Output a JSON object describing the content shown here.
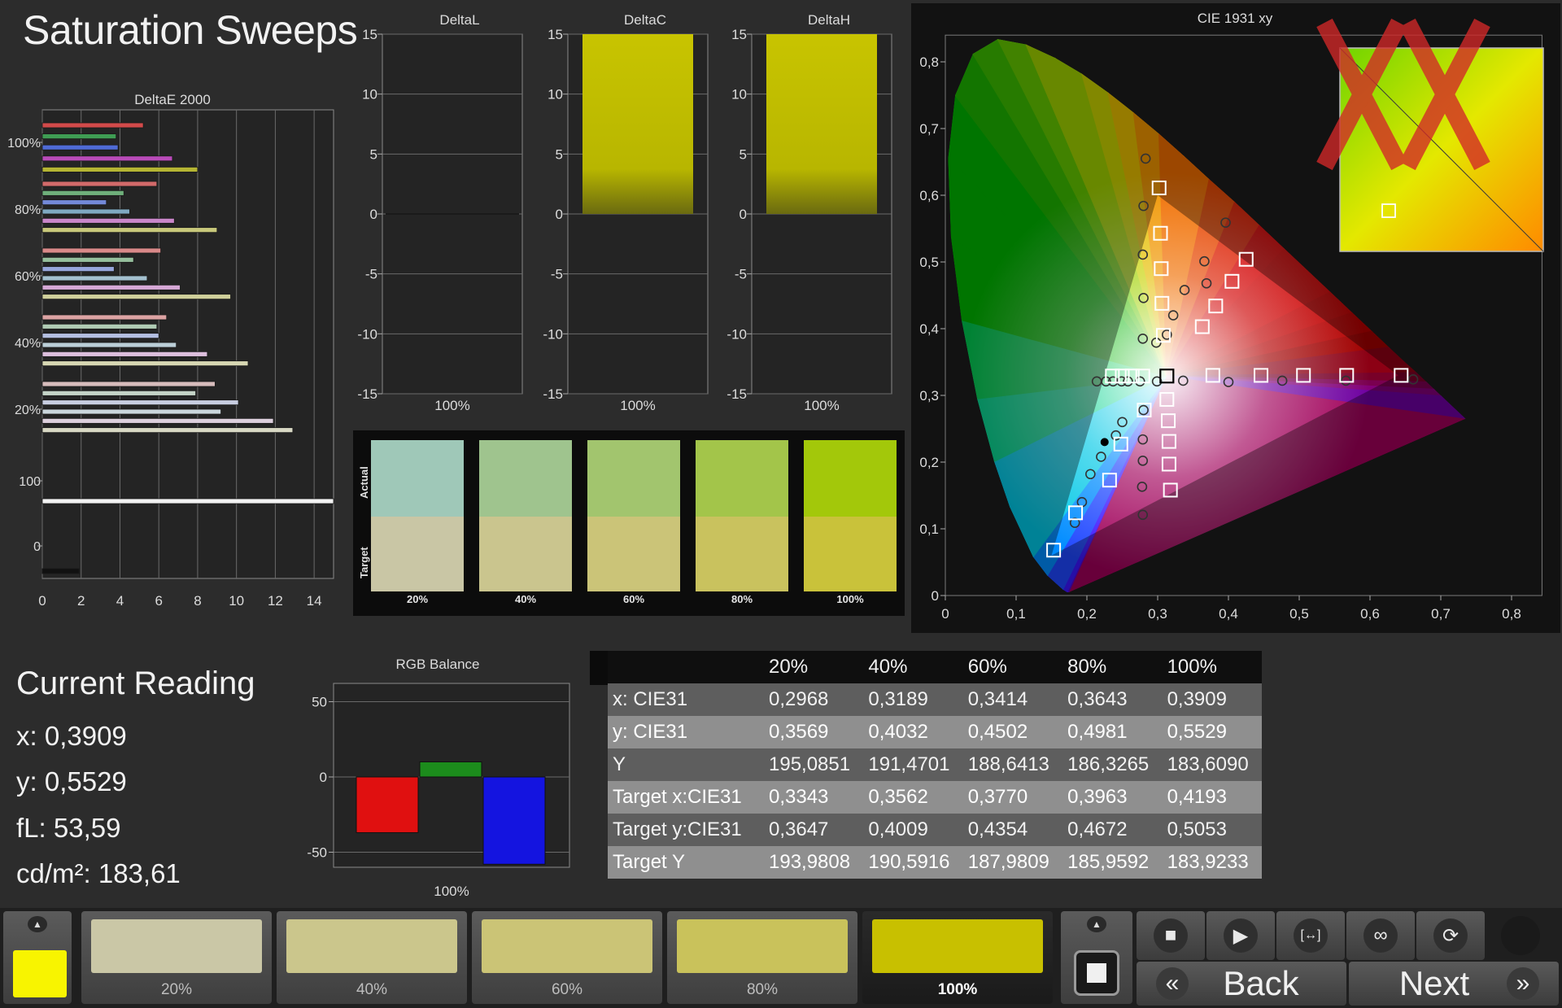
{
  "app": {
    "title": "Saturation Sweeps",
    "logo_icon": "watermark-x-icon"
  },
  "deltae": {
    "title": "DeltaE 2000",
    "xticks": [
      "0",
      "2",
      "4",
      "6",
      "8",
      "10",
      "12",
      "14"
    ],
    "yticks": [
      "100%",
      "80%",
      "60%",
      "40%",
      "20%",
      "100",
      "0"
    ],
    "groups": [
      {
        "label": "100%",
        "bars": [
          {
            "v": 5.2,
            "c": "#d24a4a"
          },
          {
            "v": 3.8,
            "c": "#3f9d54"
          },
          {
            "v": 3.9,
            "c": "#4f6bd6"
          },
          {
            "v": 6.7,
            "c": "#b94bb9"
          },
          {
            "v": 8.0,
            "c": "#b5b533"
          }
        ]
      },
      {
        "label": "80%",
        "bars": [
          {
            "v": 5.9,
            "c": "#d26a6a"
          },
          {
            "v": 4.2,
            "c": "#6fb07b"
          },
          {
            "v": 3.3,
            "c": "#7389d8"
          },
          {
            "v": 4.5,
            "c": "#7fa9c2"
          },
          {
            "v": 6.8,
            "c": "#c986c9"
          },
          {
            "v": 9.0,
            "c": "#c8c87b"
          }
        ]
      },
      {
        "label": "60%",
        "bars": [
          {
            "v": 6.1,
            "c": "#d98989"
          },
          {
            "v": 4.7,
            "c": "#96bf9d"
          },
          {
            "v": 3.7,
            "c": "#97a6dc"
          },
          {
            "v": 5.4,
            "c": "#a4c0cf"
          },
          {
            "v": 7.1,
            "c": "#d6a8d6"
          },
          {
            "v": 9.7,
            "c": "#d0d09b"
          }
        ]
      },
      {
        "label": "40%",
        "bars": [
          {
            "v": 6.4,
            "c": "#dca3a3"
          },
          {
            "v": 5.9,
            "c": "#b0cbb4"
          },
          {
            "v": 6.0,
            "c": "#b4bfe1"
          },
          {
            "v": 6.9,
            "c": "#bccfd8"
          },
          {
            "v": 8.5,
            "c": "#ddbfdd"
          },
          {
            "v": 10.6,
            "c": "#d7d7b3"
          }
        ]
      },
      {
        "label": "20%",
        "bars": [
          {
            "v": 8.9,
            "c": "#d7bcbc"
          },
          {
            "v": 7.9,
            "c": "#c4d3c7"
          },
          {
            "v": 10.1,
            "c": "#c7cde0"
          },
          {
            "v": 9.2,
            "c": "#cad6dc"
          },
          {
            "v": 11.9,
            "c": "#dccfdc"
          },
          {
            "v": 12.9,
            "c": "#d8d8c4"
          }
        ]
      },
      {
        "label": "100",
        "bars": [
          {
            "v": 15.0,
            "c": "#f2f2f2"
          }
        ]
      },
      {
        "label": "0",
        "bars": [
          {
            "v": 1.9,
            "c": "#111111"
          }
        ]
      }
    ]
  },
  "delta_charts": [
    {
      "title": "DeltaL",
      "value": 0,
      "xlabel": "100%"
    },
    {
      "title": "DeltaC",
      "value": 15,
      "xlabel": "100%"
    },
    {
      "title": "DeltaH",
      "value": 15,
      "xlabel": "100%"
    }
  ],
  "delta_yticks": [
    "15",
    "10",
    "5",
    "0",
    "-5",
    "-10",
    "-15"
  ],
  "swatches": {
    "actual_label": "Actual",
    "target_label": "Target",
    "items": [
      {
        "label": "20%",
        "actual": "#9fc8b8",
        "target": "#c9c6a5"
      },
      {
        "label": "40%",
        "actual": "#9fc48e",
        "target": "#cac58e"
      },
      {
        "label": "60%",
        "actual": "#a2c56e",
        "target": "#cbc478"
      },
      {
        "label": "80%",
        "actual": "#a3c54a",
        "target": "#c9c25e"
      },
      {
        "label": "100%",
        "actual": "#a3c80a",
        "target": "#c9c23a"
      }
    ]
  },
  "cie": {
    "title": "CIE 1931 xy",
    "xticks": [
      "0",
      "0,1",
      "0,2",
      "0,3",
      "0,4",
      "0,5",
      "0,6",
      "0,7",
      "0,8"
    ],
    "yticks": [
      "0",
      "0,1",
      "0,2",
      "0,3",
      "0,4",
      "0,5",
      "0,6",
      "0,7",
      "0,8"
    ],
    "targets": [
      [
        0.302,
        0.611
      ],
      [
        0.304,
        0.543
      ],
      [
        0.305,
        0.49
      ],
      [
        0.306,
        0.438
      ],
      [
        0.308,
        0.39
      ],
      [
        0.382,
        0.434
      ],
      [
        0.405,
        0.471
      ],
      [
        0.425,
        0.504
      ],
      [
        0.363,
        0.403
      ],
      [
        0.236,
        0.329
      ],
      [
        0.25,
        0.329
      ],
      [
        0.264,
        0.329
      ],
      [
        0.279,
        0.329
      ],
      [
        0.313,
        0.329
      ],
      [
        0.378,
        0.33
      ],
      [
        0.446,
        0.33
      ],
      [
        0.506,
        0.33
      ],
      [
        0.567,
        0.33
      ],
      [
        0.644,
        0.33
      ],
      [
        0.313,
        0.294
      ],
      [
        0.281,
        0.278
      ],
      [
        0.315,
        0.262
      ],
      [
        0.316,
        0.231
      ],
      [
        0.316,
        0.197
      ],
      [
        0.318,
        0.158
      ],
      [
        0.248,
        0.227
      ],
      [
        0.232,
        0.173
      ],
      [
        0.184,
        0.124
      ],
      [
        0.153,
        0.068
      ]
    ],
    "measured": [
      [
        0.283,
        0.655
      ],
      [
        0.28,
        0.584
      ],
      [
        0.279,
        0.511
      ],
      [
        0.28,
        0.446
      ],
      [
        0.279,
        0.385
      ],
      [
        0.298,
        0.379
      ],
      [
        0.313,
        0.391
      ],
      [
        0.322,
        0.42
      ],
      [
        0.338,
        0.458
      ],
      [
        0.366,
        0.501
      ],
      [
        0.369,
        0.468
      ],
      [
        0.396,
        0.559
      ],
      [
        0.214,
        0.321
      ],
      [
        0.227,
        0.321
      ],
      [
        0.237,
        0.321
      ],
      [
        0.249,
        0.321
      ],
      [
        0.258,
        0.321
      ],
      [
        0.275,
        0.321
      ],
      [
        0.299,
        0.321
      ],
      [
        0.336,
        0.322
      ],
      [
        0.4,
        0.32
      ],
      [
        0.476,
        0.322
      ],
      [
        0.566,
        0.322
      ],
      [
        0.661,
        0.324
      ],
      [
        0.28,
        0.278
      ],
      [
        0.25,
        0.26
      ],
      [
        0.241,
        0.24
      ],
      [
        0.279,
        0.234
      ],
      [
        0.279,
        0.202
      ],
      [
        0.278,
        0.163
      ],
      [
        0.279,
        0.121
      ],
      [
        0.22,
        0.208
      ],
      [
        0.205,
        0.182
      ],
      [
        0.193,
        0.14
      ],
      [
        0.183,
        0.109
      ]
    ],
    "current_xy": [
      0.3909,
      0.5529
    ],
    "current_dot": [
      0.225,
      0.23
    ],
    "inset_square": [
      0.74,
      0.66
    ]
  },
  "reading": {
    "title": "Current Reading",
    "x": "x: 0,3909",
    "y": "y: 0,5529",
    "fl": "fL: 53,59",
    "cdm2": "cd/m²: 183,61"
  },
  "rgb_balance": {
    "title": "RGB Balance",
    "yticks": [
      "50",
      "0",
      "-50"
    ],
    "xlabel": "100%",
    "values": [
      {
        "v": -37,
        "c": "#e01010"
      },
      {
        "v": 10,
        "c": "#1c8c1c"
      },
      {
        "v": -58,
        "c": "#1414e0"
      }
    ]
  },
  "table": {
    "columns": [
      "",
      "20%",
      "40%",
      "60%",
      "80%",
      "100%"
    ],
    "rows": [
      [
        "x: CIE31",
        "0,2968",
        "0,3189",
        "0,3414",
        "0,3643",
        "0,3909"
      ],
      [
        "y: CIE31",
        "0,3569",
        "0,4032",
        "0,4502",
        "0,4981",
        "0,5529"
      ],
      [
        "Y",
        "195,0851",
        "191,4701",
        "188,6413",
        "186,3265",
        "183,6090"
      ],
      [
        "Target x:CIE31",
        "0,3343",
        "0,3562",
        "0,3770",
        "0,3963",
        "0,4193"
      ],
      [
        "Target y:CIE31",
        "0,3647",
        "0,4009",
        "0,4354",
        "0,4672",
        "0,5053"
      ],
      [
        "Target Y",
        "193,9808",
        "190,5916",
        "187,9809",
        "185,9592",
        "183,9233"
      ]
    ]
  },
  "bottom": {
    "color_indicator": "#f8f400",
    "saturations": [
      {
        "label": "20%",
        "color": "#cac7a6"
      },
      {
        "label": "40%",
        "color": "#cbc68c"
      },
      {
        "label": "60%",
        "color": "#cbc476"
      },
      {
        "label": "80%",
        "color": "#c9c25b"
      },
      {
        "label": "100%",
        "color": "#c8c000"
      }
    ],
    "transport": [
      "stop-icon",
      "play-icon",
      "fit-icon",
      "loop-icon",
      "refresh-icon"
    ],
    "back_label": "Back",
    "next_label": "Next"
  }
}
